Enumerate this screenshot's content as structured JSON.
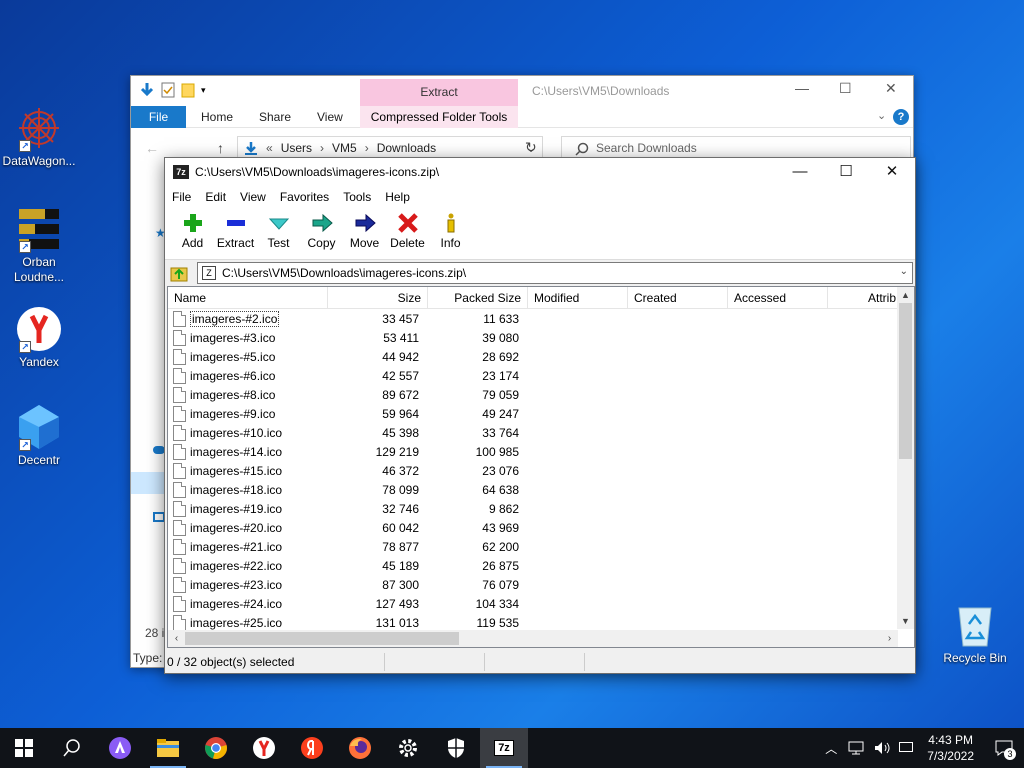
{
  "desktop": {
    "icons": [
      {
        "label": "DataWagon...",
        "name": "datawagon-icon"
      },
      {
        "label": "Orban Loudne...",
        "name": "orban-loudness-icon"
      },
      {
        "label": "Yandex",
        "name": "yandex-browser-icon"
      },
      {
        "label": "Decentr",
        "name": "decentr-icon"
      }
    ],
    "recycle_label": "Recycle Bin"
  },
  "explorer": {
    "extract_tab": "Extract",
    "title_path": "C:\\Users\\VM5\\Downloads",
    "ribbon_tabs": {
      "file": "File",
      "home": "Home",
      "share": "Share",
      "view": "View",
      "compressed": "Compressed Folder Tools"
    },
    "address": {
      "part1": "Users",
      "part2": "VM5",
      "part3": "Downloads"
    },
    "search_placeholder": "Search Downloads",
    "status_count": "28 i",
    "type_text": "Type:"
  },
  "zip": {
    "title": "C:\\Users\\VM5\\Downloads\\imageres-icons.zip\\",
    "logo": "7z",
    "menu": [
      "File",
      "Edit",
      "View",
      "Favorites",
      "Tools",
      "Help"
    ],
    "toolbar": [
      "Add",
      "Extract",
      "Test",
      "Copy",
      "Move",
      "Delete",
      "Info"
    ],
    "address": "C:\\Users\\VM5\\Downloads\\imageres-icons.zip\\",
    "columns": [
      "Name",
      "Size",
      "Packed Size",
      "Modified",
      "Created",
      "Accessed",
      "Attrib"
    ],
    "rows": [
      {
        "name": "imageres-#2.ico",
        "size": "33 457",
        "packed": "11 633"
      },
      {
        "name": "imageres-#3.ico",
        "size": "53 411",
        "packed": "39 080"
      },
      {
        "name": "imageres-#5.ico",
        "size": "44 942",
        "packed": "28 692"
      },
      {
        "name": "imageres-#6.ico",
        "size": "42 557",
        "packed": "23 174"
      },
      {
        "name": "imageres-#8.ico",
        "size": "89 672",
        "packed": "79 059"
      },
      {
        "name": "imageres-#9.ico",
        "size": "59 964",
        "packed": "49 247"
      },
      {
        "name": "imageres-#10.ico",
        "size": "45 398",
        "packed": "33 764"
      },
      {
        "name": "imageres-#14.ico",
        "size": "129 219",
        "packed": "100 985"
      },
      {
        "name": "imageres-#15.ico",
        "size": "46 372",
        "packed": "23 076"
      },
      {
        "name": "imageres-#18.ico",
        "size": "78 099",
        "packed": "64 638"
      },
      {
        "name": "imageres-#19.ico",
        "size": "32 746",
        "packed": "9 862"
      },
      {
        "name": "imageres-#20.ico",
        "size": "60 042",
        "packed": "43 969"
      },
      {
        "name": "imageres-#21.ico",
        "size": "78 877",
        "packed": "62 200"
      },
      {
        "name": "imageres-#22.ico",
        "size": "45 189",
        "packed": "26 875"
      },
      {
        "name": "imageres-#23.ico",
        "size": "87 300",
        "packed": "76 079"
      },
      {
        "name": "imageres-#24.ico",
        "size": "127 493",
        "packed": "104 334"
      },
      {
        "name": "imageres-#25.ico",
        "size": "131 013",
        "packed": "119 535"
      }
    ],
    "status": "0 / 32 object(s) selected"
  },
  "taskbar": {
    "clock_time": "4:43 PM",
    "clock_date": "7/3/2022",
    "notification_count": "3"
  },
  "colors": {
    "accent": "#1979ca",
    "extract_tab": "#f9c6e0",
    "taskbar": "#101318"
  }
}
